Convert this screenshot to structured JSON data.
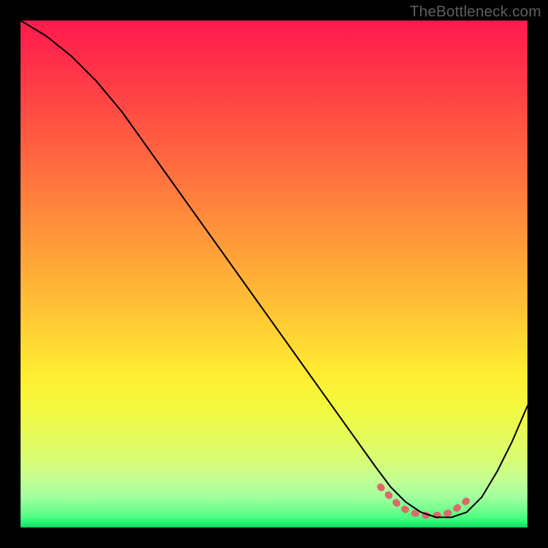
{
  "watermark": "TheBottleneck.com",
  "chart_data": {
    "type": "line",
    "title": "",
    "xlabel": "",
    "ylabel": "",
    "xlim": [
      0,
      100
    ],
    "ylim": [
      0,
      100
    ],
    "x": [
      0,
      5,
      10,
      15,
      20,
      25,
      30,
      35,
      40,
      45,
      50,
      55,
      60,
      65,
      70,
      73,
      76,
      79,
      82,
      85,
      88,
      91,
      94,
      97,
      100
    ],
    "values": [
      100,
      97,
      93,
      88,
      82,
      75,
      68,
      61,
      54,
      47,
      40,
      33,
      26,
      19,
      12,
      8,
      5,
      3,
      2,
      2,
      3,
      6,
      11,
      17,
      24
    ],
    "valley": {
      "x": [
        71,
        73,
        75,
        77,
        79,
        81,
        83,
        85,
        87,
        89
      ],
      "values": [
        8,
        6,
        4,
        3,
        2.5,
        2.3,
        2.5,
        3,
        4.5,
        6
      ]
    },
    "gradient": [
      {
        "offset": 0.0,
        "color": "#ff1a4d"
      },
      {
        "offset": 0.08,
        "color": "#ff2e4a"
      },
      {
        "offset": 0.16,
        "color": "#ff4645"
      },
      {
        "offset": 0.24,
        "color": "#ff5e41"
      },
      {
        "offset": 0.32,
        "color": "#ff763e"
      },
      {
        "offset": 0.4,
        "color": "#ff8f3b"
      },
      {
        "offset": 0.48,
        "color": "#ffa738"
      },
      {
        "offset": 0.56,
        "color": "#ffbf35"
      },
      {
        "offset": 0.63,
        "color": "#ffd733"
      },
      {
        "offset": 0.7,
        "color": "#ffee31"
      },
      {
        "offset": 0.76,
        "color": "#f4f83d"
      },
      {
        "offset": 0.82,
        "color": "#e6fb5a"
      },
      {
        "offset": 0.87,
        "color": "#d6fc77"
      },
      {
        "offset": 0.905,
        "color": "#c3fe92"
      },
      {
        "offset": 0.935,
        "color": "#a7ff9e"
      },
      {
        "offset": 0.96,
        "color": "#7cff92"
      },
      {
        "offset": 0.98,
        "color": "#4dff80"
      },
      {
        "offset": 0.992,
        "color": "#23f06e"
      },
      {
        "offset": 1.0,
        "color": "#0ad85f"
      }
    ]
  }
}
